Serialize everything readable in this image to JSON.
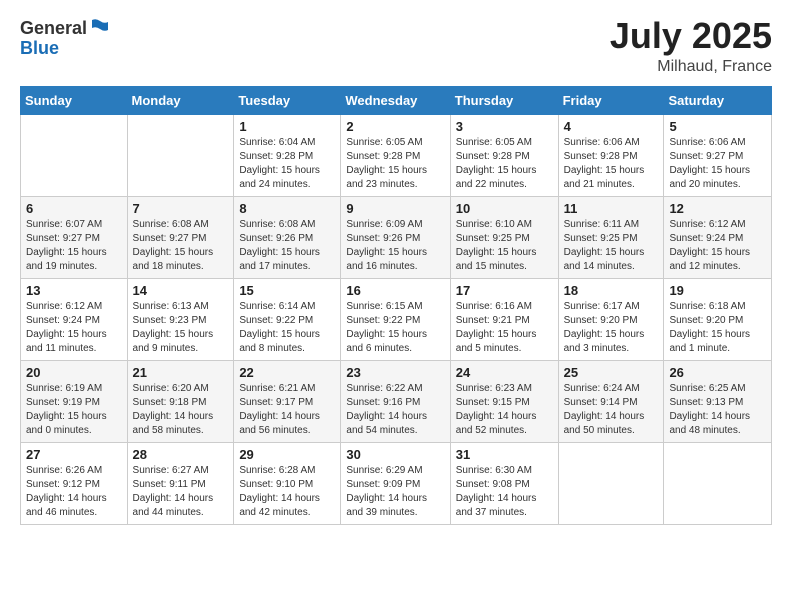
{
  "header": {
    "logo_line1": "General",
    "logo_line2": "Blue",
    "month": "July 2025",
    "location": "Milhaud, France"
  },
  "weekdays": [
    "Sunday",
    "Monday",
    "Tuesday",
    "Wednesday",
    "Thursday",
    "Friday",
    "Saturday"
  ],
  "weeks": [
    [
      {
        "day": "",
        "sunrise": "",
        "sunset": "",
        "daylight": ""
      },
      {
        "day": "",
        "sunrise": "",
        "sunset": "",
        "daylight": ""
      },
      {
        "day": "1",
        "sunrise": "Sunrise: 6:04 AM",
        "sunset": "Sunset: 9:28 PM",
        "daylight": "Daylight: 15 hours and 24 minutes."
      },
      {
        "day": "2",
        "sunrise": "Sunrise: 6:05 AM",
        "sunset": "Sunset: 9:28 PM",
        "daylight": "Daylight: 15 hours and 23 minutes."
      },
      {
        "day": "3",
        "sunrise": "Sunrise: 6:05 AM",
        "sunset": "Sunset: 9:28 PM",
        "daylight": "Daylight: 15 hours and 22 minutes."
      },
      {
        "day": "4",
        "sunrise": "Sunrise: 6:06 AM",
        "sunset": "Sunset: 9:28 PM",
        "daylight": "Daylight: 15 hours and 21 minutes."
      },
      {
        "day": "5",
        "sunrise": "Sunrise: 6:06 AM",
        "sunset": "Sunset: 9:27 PM",
        "daylight": "Daylight: 15 hours and 20 minutes."
      }
    ],
    [
      {
        "day": "6",
        "sunrise": "Sunrise: 6:07 AM",
        "sunset": "Sunset: 9:27 PM",
        "daylight": "Daylight: 15 hours and 19 minutes."
      },
      {
        "day": "7",
        "sunrise": "Sunrise: 6:08 AM",
        "sunset": "Sunset: 9:27 PM",
        "daylight": "Daylight: 15 hours and 18 minutes."
      },
      {
        "day": "8",
        "sunrise": "Sunrise: 6:08 AM",
        "sunset": "Sunset: 9:26 PM",
        "daylight": "Daylight: 15 hours and 17 minutes."
      },
      {
        "day": "9",
        "sunrise": "Sunrise: 6:09 AM",
        "sunset": "Sunset: 9:26 PM",
        "daylight": "Daylight: 15 hours and 16 minutes."
      },
      {
        "day": "10",
        "sunrise": "Sunrise: 6:10 AM",
        "sunset": "Sunset: 9:25 PM",
        "daylight": "Daylight: 15 hours and 15 minutes."
      },
      {
        "day": "11",
        "sunrise": "Sunrise: 6:11 AM",
        "sunset": "Sunset: 9:25 PM",
        "daylight": "Daylight: 15 hours and 14 minutes."
      },
      {
        "day": "12",
        "sunrise": "Sunrise: 6:12 AM",
        "sunset": "Sunset: 9:24 PM",
        "daylight": "Daylight: 15 hours and 12 minutes."
      }
    ],
    [
      {
        "day": "13",
        "sunrise": "Sunrise: 6:12 AM",
        "sunset": "Sunset: 9:24 PM",
        "daylight": "Daylight: 15 hours and 11 minutes."
      },
      {
        "day": "14",
        "sunrise": "Sunrise: 6:13 AM",
        "sunset": "Sunset: 9:23 PM",
        "daylight": "Daylight: 15 hours and 9 minutes."
      },
      {
        "day": "15",
        "sunrise": "Sunrise: 6:14 AM",
        "sunset": "Sunset: 9:22 PM",
        "daylight": "Daylight: 15 hours and 8 minutes."
      },
      {
        "day": "16",
        "sunrise": "Sunrise: 6:15 AM",
        "sunset": "Sunset: 9:22 PM",
        "daylight": "Daylight: 15 hours and 6 minutes."
      },
      {
        "day": "17",
        "sunrise": "Sunrise: 6:16 AM",
        "sunset": "Sunset: 9:21 PM",
        "daylight": "Daylight: 15 hours and 5 minutes."
      },
      {
        "day": "18",
        "sunrise": "Sunrise: 6:17 AM",
        "sunset": "Sunset: 9:20 PM",
        "daylight": "Daylight: 15 hours and 3 minutes."
      },
      {
        "day": "19",
        "sunrise": "Sunrise: 6:18 AM",
        "sunset": "Sunset: 9:20 PM",
        "daylight": "Daylight: 15 hours and 1 minute."
      }
    ],
    [
      {
        "day": "20",
        "sunrise": "Sunrise: 6:19 AM",
        "sunset": "Sunset: 9:19 PM",
        "daylight": "Daylight: 15 hours and 0 minutes."
      },
      {
        "day": "21",
        "sunrise": "Sunrise: 6:20 AM",
        "sunset": "Sunset: 9:18 PM",
        "daylight": "Daylight: 14 hours and 58 minutes."
      },
      {
        "day": "22",
        "sunrise": "Sunrise: 6:21 AM",
        "sunset": "Sunset: 9:17 PM",
        "daylight": "Daylight: 14 hours and 56 minutes."
      },
      {
        "day": "23",
        "sunrise": "Sunrise: 6:22 AM",
        "sunset": "Sunset: 9:16 PM",
        "daylight": "Daylight: 14 hours and 54 minutes."
      },
      {
        "day": "24",
        "sunrise": "Sunrise: 6:23 AM",
        "sunset": "Sunset: 9:15 PM",
        "daylight": "Daylight: 14 hours and 52 minutes."
      },
      {
        "day": "25",
        "sunrise": "Sunrise: 6:24 AM",
        "sunset": "Sunset: 9:14 PM",
        "daylight": "Daylight: 14 hours and 50 minutes."
      },
      {
        "day": "26",
        "sunrise": "Sunrise: 6:25 AM",
        "sunset": "Sunset: 9:13 PM",
        "daylight": "Daylight: 14 hours and 48 minutes."
      }
    ],
    [
      {
        "day": "27",
        "sunrise": "Sunrise: 6:26 AM",
        "sunset": "Sunset: 9:12 PM",
        "daylight": "Daylight: 14 hours and 46 minutes."
      },
      {
        "day": "28",
        "sunrise": "Sunrise: 6:27 AM",
        "sunset": "Sunset: 9:11 PM",
        "daylight": "Daylight: 14 hours and 44 minutes."
      },
      {
        "day": "29",
        "sunrise": "Sunrise: 6:28 AM",
        "sunset": "Sunset: 9:10 PM",
        "daylight": "Daylight: 14 hours and 42 minutes."
      },
      {
        "day": "30",
        "sunrise": "Sunrise: 6:29 AM",
        "sunset": "Sunset: 9:09 PM",
        "daylight": "Daylight: 14 hours and 39 minutes."
      },
      {
        "day": "31",
        "sunrise": "Sunrise: 6:30 AM",
        "sunset": "Sunset: 9:08 PM",
        "daylight": "Daylight: 14 hours and 37 minutes."
      },
      {
        "day": "",
        "sunrise": "",
        "sunset": "",
        "daylight": ""
      },
      {
        "day": "",
        "sunrise": "",
        "sunset": "",
        "daylight": ""
      }
    ]
  ]
}
